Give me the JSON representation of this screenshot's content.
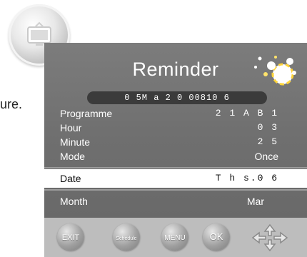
{
  "background_fragment": "ure.",
  "reminder": {
    "title": "Reminder",
    "current_time": "0 5M a 2 0 00810 6",
    "fields": [
      {
        "label": "Programme",
        "value": "2 1 A B 1"
      },
      {
        "label": "Hour",
        "value": "0 3"
      },
      {
        "label": "Minute",
        "value": "2 5"
      },
      {
        "label": "Mode",
        "value": "Once"
      }
    ],
    "date": {
      "label": "Date",
      "value": "T h s.0 6"
    },
    "month": {
      "label": "Month",
      "value": "Mar"
    }
  },
  "buttons": {
    "exit": "EXIT",
    "schedule": "Schedule",
    "menu": "MENU",
    "ok": "OK"
  },
  "icons": {
    "logo": "tv-logo-icon",
    "decoration": "bubbles-icon",
    "navigation": "directional-arrows-icon"
  },
  "colors": {
    "panel": "#6f6f6f",
    "button_bar": "#bdbdbd",
    "highlight_row": "#ffffff",
    "time_bar": "#3b3b3b"
  }
}
